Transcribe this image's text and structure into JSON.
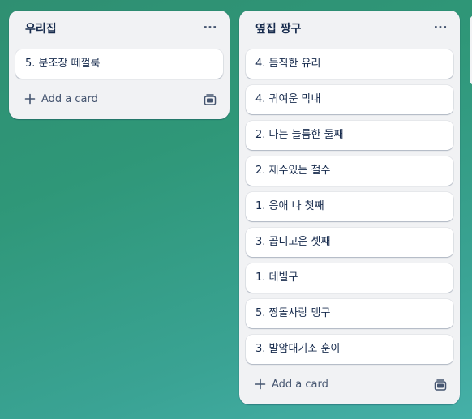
{
  "lists": [
    {
      "title": "우리집",
      "menu_icon": "ellipsis-icon",
      "cards": [
        "5. 분조장 떼껄룩"
      ],
      "add_card_label": "Add a card"
    },
    {
      "title": "옆집 짱구",
      "menu_icon": "ellipsis-icon",
      "cards": [
        "4. 듬직한 유리",
        "4. 귀여운 막내",
        "2. 나는 늘름한 둘째",
        "2. 재수있는 철수",
        "1. 응애 나 첫째",
        "3. 곱디고운 셋째",
        "1. 데빌구",
        "5. 짱돌사랑 맹구",
        "3. 발암대기조 훈이"
      ],
      "add_card_label": "Add a card"
    }
  ],
  "colors": {
    "board_background": "#2f9778",
    "list_background": "#f1f2f4",
    "card_background": "#ffffff",
    "text": "#172b4d",
    "muted_text": "#44546f"
  },
  "icons": {
    "add": "plus-icon",
    "template": "card-template-icon"
  }
}
